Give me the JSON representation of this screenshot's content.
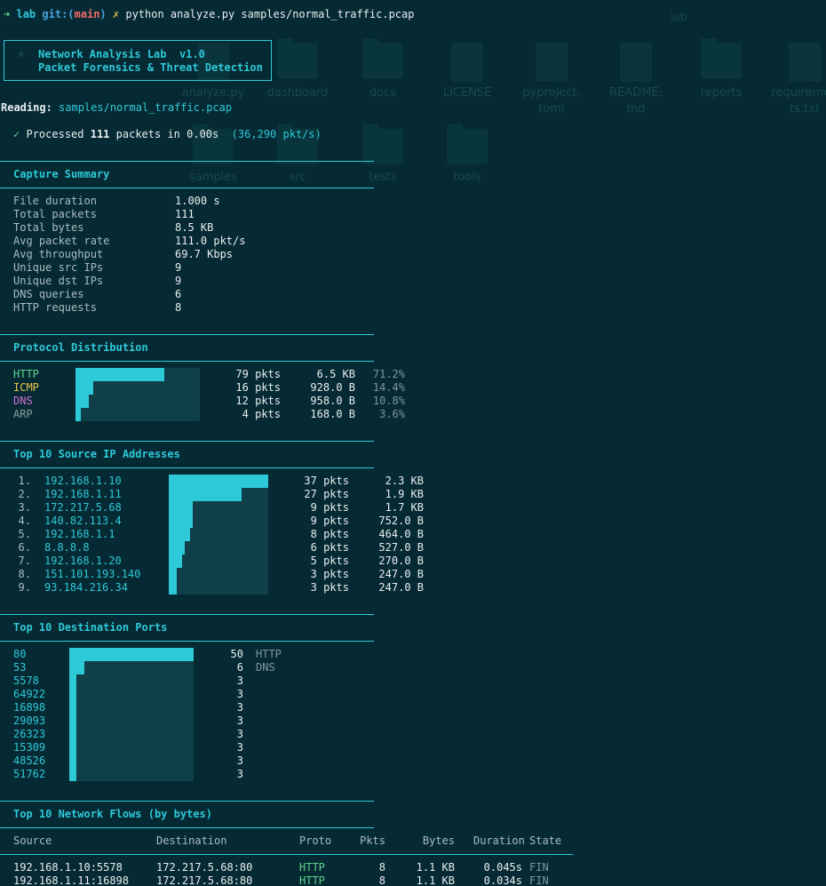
{
  "background_ghost": {
    "window_title": "lab",
    "files": [
      {
        "name": "analyze.py",
        "kind": "file"
      },
      {
        "name": "dashboard",
        "kind": "folder"
      },
      {
        "name": "docs",
        "kind": "folder"
      },
      {
        "name": "LICENSE",
        "kind": "file"
      },
      {
        "name": "pyproject.\ntoml",
        "kind": "file"
      },
      {
        "name": "README.\nmd",
        "kind": "file"
      },
      {
        "name": "reports",
        "kind": "folder"
      },
      {
        "name": "requiremen\nts.txt",
        "kind": "file"
      },
      {
        "name": "samples",
        "kind": "folder"
      },
      {
        "name": "src",
        "kind": "folder"
      },
      {
        "name": "tests",
        "kind": "folder"
      },
      {
        "name": "tools",
        "kind": "folder"
      }
    ]
  },
  "prompt": {
    "arrow": "➜",
    "dir": "lab",
    "git_label": "git:(",
    "branch": "main",
    "git_close": ")",
    "dirty": "✗",
    "command": "python analyze.py samples/normal_traffic.pcap"
  },
  "banner": {
    "line1": "Network Analysis Lab  v1.0",
    "line2": "Packet Forensics & Threat Detection"
  },
  "reading": {
    "label": "Reading:",
    "path": "samples/normal_traffic.pcap"
  },
  "processed": {
    "check": "✓",
    "prefix": "Processed",
    "count": "111",
    "middle": "packets in 0.00s",
    "rate": "(36,290 pkt/s)"
  },
  "capture_summary": {
    "title": "Capture Summary",
    "rows": [
      {
        "label": "File duration",
        "value": "1.000 s"
      },
      {
        "label": "Total packets",
        "value": "111"
      },
      {
        "label": "Total bytes",
        "value": "8.5 KB"
      },
      {
        "label": "Avg packet rate",
        "value": "111.0 pkt/s"
      },
      {
        "label": "Avg throughput",
        "value": "69.7 Kbps"
      },
      {
        "label": "Unique src IPs",
        "value": "9"
      },
      {
        "label": "Unique dst IPs",
        "value": "9"
      },
      {
        "label": "DNS queries",
        "value": "6"
      },
      {
        "label": "HTTP requests",
        "value": "8"
      }
    ]
  },
  "protocol_distribution": {
    "title": "Protocol Distribution",
    "rows": [
      {
        "proto": "HTTP",
        "pkts": "79 pkts",
        "bytes": "6.5 KB",
        "pct": "71.2%",
        "fraction": 0.712,
        "color": "#5fd38d"
      },
      {
        "proto": "ICMP",
        "pkts": "16 pkts",
        "bytes": "928.0 B",
        "pct": "14.4%",
        "fraction": 0.144,
        "color": "#e6c34d"
      },
      {
        "proto": "DNS",
        "pkts": "12 pkts",
        "bytes": "958.0 B",
        "pct": "10.8%",
        "fraction": 0.108,
        "color": "#d070d6"
      },
      {
        "proto": "ARP",
        "pkts": "4 pkts",
        "bytes": "168.0 B",
        "pct": "3.6%",
        "fraction": 0.036,
        "color": "#8a9ca0"
      }
    ]
  },
  "top_src_ips": {
    "title": "Top 10 Source IP Addresses",
    "rows": [
      {
        "rank": "1.",
        "ip": "192.168.1.10",
        "pkts": "37 pkts",
        "bytes": "2.3 KB",
        "count": 37
      },
      {
        "rank": "2.",
        "ip": "192.168.1.11",
        "pkts": "27 pkts",
        "bytes": "1.9 KB",
        "count": 27
      },
      {
        "rank": "3.",
        "ip": "172.217.5.68",
        "pkts": "9 pkts",
        "bytes": "1.7 KB",
        "count": 9
      },
      {
        "rank": "4.",
        "ip": "140.82.113.4",
        "pkts": "9 pkts",
        "bytes": "752.0 B",
        "count": 9
      },
      {
        "rank": "5.",
        "ip": "192.168.1.1",
        "pkts": "8 pkts",
        "bytes": "464.0 B",
        "count": 8
      },
      {
        "rank": "6.",
        "ip": "8.8.8.8",
        "pkts": "6 pkts",
        "bytes": "527.0 B",
        "count": 6
      },
      {
        "rank": "7.",
        "ip": "192.168.1.20",
        "pkts": "5 pkts",
        "bytes": "270.0 B",
        "count": 5
      },
      {
        "rank": "8.",
        "ip": "151.101.193.140",
        "pkts": "3 pkts",
        "bytes": "247.0 B",
        "count": 3
      },
      {
        "rank": "9.",
        "ip": "93.184.216.34",
        "pkts": "3 pkts",
        "bytes": "247.0 B",
        "count": 3
      }
    ]
  },
  "top_dst_ports": {
    "title": "Top 10 Destination Ports",
    "rows": [
      {
        "port": "80",
        "count": "50",
        "service": "HTTP",
        "n": 50
      },
      {
        "port": "53",
        "count": "6",
        "service": "DNS",
        "n": 6
      },
      {
        "port": "5578",
        "count": "3",
        "service": "",
        "n": 3
      },
      {
        "port": "64922",
        "count": "3",
        "service": "",
        "n": 3
      },
      {
        "port": "16898",
        "count": "3",
        "service": "",
        "n": 3
      },
      {
        "port": "29093",
        "count": "3",
        "service": "",
        "n": 3
      },
      {
        "port": "26323",
        "count": "3",
        "service": "",
        "n": 3
      },
      {
        "port": "15309",
        "count": "3",
        "service": "",
        "n": 3
      },
      {
        "port": "48526",
        "count": "3",
        "service": "",
        "n": 3
      },
      {
        "port": "51762",
        "count": "3",
        "service": "",
        "n": 3
      }
    ]
  },
  "top_flows": {
    "title": "Top 10 Network Flows (by bytes)",
    "headers": {
      "source": "Source",
      "destination": "Destination",
      "proto": "Proto",
      "pkts": "Pkts",
      "bytes": "Bytes",
      "duration": "Duration",
      "state": "State"
    },
    "rows": [
      {
        "source": "192.168.1.10:5578",
        "destination": "172.217.5.68:80",
        "proto": "HTTP",
        "pkts": "8",
        "bytes": "1.1 KB",
        "duration": "0.045s",
        "state": "FIN"
      },
      {
        "source": "192.168.1.11:16898",
        "destination": "172.217.5.68:80",
        "proto": "HTTP",
        "pkts": "8",
        "bytes": "1.1 KB",
        "duration": "0.034s",
        "state": "FIN"
      }
    ]
  }
}
